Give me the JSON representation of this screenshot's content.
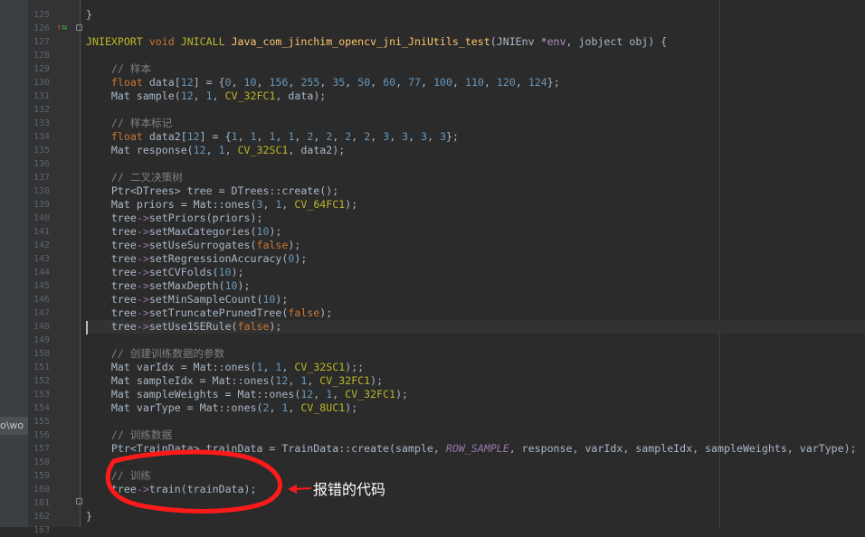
{
  "sidebar_fragment": "o\\wo",
  "line_numbers": [
    "125",
    "126",
    "127",
    "128",
    "129",
    "130",
    "131",
    "132",
    "133",
    "134",
    "135",
    "136",
    "137",
    "138",
    "139",
    "140",
    "141",
    "142",
    "143",
    "144",
    "145",
    "146",
    "147",
    "148",
    "149",
    "150",
    "151",
    "152",
    "153",
    "154",
    "155",
    "156",
    "157",
    "158",
    "159",
    "160",
    "161",
    "162",
    "163"
  ],
  "code_lines": [
    [
      {
        "t": "}",
        "c": ""
      }
    ],
    [],
    [
      {
        "t": "JNIEXPORT ",
        "c": "const"
      },
      {
        "t": "void ",
        "c": "kw"
      },
      {
        "t": "JNICALL ",
        "c": "const"
      },
      {
        "t": "Java_com_jinchim_opencv_jni_JniUtils_test",
        "c": "fn-name"
      },
      {
        "t": "(JNIEnv *",
        "c": ""
      },
      {
        "t": "env",
        "c": "param-env"
      },
      {
        "t": ", jobject ",
        "c": ""
      },
      {
        "t": "obj",
        "c": "param-obj"
      },
      {
        "t": ") {",
        "c": ""
      }
    ],
    [],
    [
      {
        "t": "    // 样本",
        "c": "cmt"
      }
    ],
    [
      {
        "t": "    ",
        "c": ""
      },
      {
        "t": "float ",
        "c": "kw"
      },
      {
        "t": "data[",
        "c": ""
      },
      {
        "t": "12",
        "c": "num"
      },
      {
        "t": "] = {",
        "c": ""
      },
      {
        "t": "0",
        "c": "num"
      },
      {
        "t": ", ",
        "c": ""
      },
      {
        "t": "10",
        "c": "num"
      },
      {
        "t": ", ",
        "c": ""
      },
      {
        "t": "156",
        "c": "num"
      },
      {
        "t": ", ",
        "c": ""
      },
      {
        "t": "255",
        "c": "num"
      },
      {
        "t": ", ",
        "c": ""
      },
      {
        "t": "35",
        "c": "num"
      },
      {
        "t": ", ",
        "c": ""
      },
      {
        "t": "50",
        "c": "num"
      },
      {
        "t": ", ",
        "c": ""
      },
      {
        "t": "60",
        "c": "num"
      },
      {
        "t": ", ",
        "c": ""
      },
      {
        "t": "77",
        "c": "num"
      },
      {
        "t": ", ",
        "c": ""
      },
      {
        "t": "100",
        "c": "num"
      },
      {
        "t": ", ",
        "c": ""
      },
      {
        "t": "110",
        "c": "num"
      },
      {
        "t": ", ",
        "c": ""
      },
      {
        "t": "120",
        "c": "num"
      },
      {
        "t": ", ",
        "c": ""
      },
      {
        "t": "124",
        "c": "num"
      },
      {
        "t": "};",
        "c": ""
      }
    ],
    [
      {
        "t": "    Mat sample(",
        "c": ""
      },
      {
        "t": "12",
        "c": "num"
      },
      {
        "t": ", ",
        "c": ""
      },
      {
        "t": "1",
        "c": "num"
      },
      {
        "t": ", ",
        "c": ""
      },
      {
        "t": "CV_32FC1",
        "c": "const"
      },
      {
        "t": ", data);",
        "c": ""
      }
    ],
    [],
    [
      {
        "t": "    // 样本标记",
        "c": "cmt"
      }
    ],
    [
      {
        "t": "    ",
        "c": ""
      },
      {
        "t": "float ",
        "c": "kw"
      },
      {
        "t": "data2[",
        "c": ""
      },
      {
        "t": "12",
        "c": "num"
      },
      {
        "t": "] = {",
        "c": ""
      },
      {
        "t": "1",
        "c": "num"
      },
      {
        "t": ", ",
        "c": ""
      },
      {
        "t": "1",
        "c": "num"
      },
      {
        "t": ", ",
        "c": ""
      },
      {
        "t": "1",
        "c": "num"
      },
      {
        "t": ", ",
        "c": ""
      },
      {
        "t": "1",
        "c": "num"
      },
      {
        "t": ", ",
        "c": ""
      },
      {
        "t": "2",
        "c": "num"
      },
      {
        "t": ", ",
        "c": ""
      },
      {
        "t": "2",
        "c": "num"
      },
      {
        "t": ", ",
        "c": ""
      },
      {
        "t": "2",
        "c": "num"
      },
      {
        "t": ", ",
        "c": ""
      },
      {
        "t": "2",
        "c": "num"
      },
      {
        "t": ", ",
        "c": ""
      },
      {
        "t": "3",
        "c": "num"
      },
      {
        "t": ", ",
        "c": ""
      },
      {
        "t": "3",
        "c": "num"
      },
      {
        "t": ", ",
        "c": ""
      },
      {
        "t": "3",
        "c": "num"
      },
      {
        "t": ", ",
        "c": ""
      },
      {
        "t": "3",
        "c": "num"
      },
      {
        "t": "};",
        "c": ""
      }
    ],
    [
      {
        "t": "    Mat response(",
        "c": ""
      },
      {
        "t": "12",
        "c": "num"
      },
      {
        "t": ", ",
        "c": ""
      },
      {
        "t": "1",
        "c": "num"
      },
      {
        "t": ", ",
        "c": ""
      },
      {
        "t": "CV_32SC1",
        "c": "const"
      },
      {
        "t": ", data2);",
        "c": ""
      }
    ],
    [],
    [
      {
        "t": "    // 二叉决策树",
        "c": "cmt"
      }
    ],
    [
      {
        "t": "    Ptr<DTrees> tree = DTrees::create();",
        "c": ""
      }
    ],
    [
      {
        "t": "    Mat priors = Mat::ones(",
        "c": ""
      },
      {
        "t": "3",
        "c": "num"
      },
      {
        "t": ", ",
        "c": ""
      },
      {
        "t": "1",
        "c": "num"
      },
      {
        "t": ", ",
        "c": ""
      },
      {
        "t": "CV_64FC1",
        "c": "const"
      },
      {
        "t": ");",
        "c": ""
      }
    ],
    [
      {
        "t": "    tree",
        "c": ""
      },
      {
        "t": "->",
        "c": "arrow"
      },
      {
        "t": "setPriors(priors);",
        "c": ""
      }
    ],
    [
      {
        "t": "    tree",
        "c": ""
      },
      {
        "t": "->",
        "c": "arrow"
      },
      {
        "t": "setMaxCategories(",
        "c": ""
      },
      {
        "t": "10",
        "c": "num"
      },
      {
        "t": ");",
        "c": ""
      }
    ],
    [
      {
        "t": "    tree",
        "c": ""
      },
      {
        "t": "->",
        "c": "arrow"
      },
      {
        "t": "setUseSurrogates(",
        "c": ""
      },
      {
        "t": "false",
        "c": "kw"
      },
      {
        "t": ");",
        "c": ""
      }
    ],
    [
      {
        "t": "    tree",
        "c": ""
      },
      {
        "t": "->",
        "c": "arrow"
      },
      {
        "t": "setRegressionAccuracy(",
        "c": ""
      },
      {
        "t": "0",
        "c": "num"
      },
      {
        "t": ");",
        "c": ""
      }
    ],
    [
      {
        "t": "    tree",
        "c": ""
      },
      {
        "t": "->",
        "c": "arrow"
      },
      {
        "t": "setCVFolds(",
        "c": ""
      },
      {
        "t": "10",
        "c": "num"
      },
      {
        "t": ");",
        "c": ""
      }
    ],
    [
      {
        "t": "    tree",
        "c": ""
      },
      {
        "t": "->",
        "c": "arrow"
      },
      {
        "t": "setMaxDepth(",
        "c": ""
      },
      {
        "t": "10",
        "c": "num"
      },
      {
        "t": ");",
        "c": ""
      }
    ],
    [
      {
        "t": "    tree",
        "c": ""
      },
      {
        "t": "->",
        "c": "arrow"
      },
      {
        "t": "setMinSampleCount(",
        "c": ""
      },
      {
        "t": "10",
        "c": "num"
      },
      {
        "t": ");",
        "c": ""
      }
    ],
    [
      {
        "t": "    tree",
        "c": ""
      },
      {
        "t": "->",
        "c": "arrow"
      },
      {
        "t": "setTruncatePrunedTree(",
        "c": ""
      },
      {
        "t": "false",
        "c": "kw"
      },
      {
        "t": ");",
        "c": ""
      }
    ],
    [
      {
        "t": "    tree",
        "c": ""
      },
      {
        "t": "->",
        "c": "arrow"
      },
      {
        "t": "setUse1SERule(",
        "c": ""
      },
      {
        "t": "false",
        "c": "kw"
      },
      {
        "t": ");",
        "c": ""
      }
    ],
    [],
    [
      {
        "t": "    // 创建训练数据的参数",
        "c": "cmt"
      }
    ],
    [
      {
        "t": "    Mat varIdx = Mat::ones(",
        "c": ""
      },
      {
        "t": "1",
        "c": "num"
      },
      {
        "t": ", ",
        "c": ""
      },
      {
        "t": "1",
        "c": "num"
      },
      {
        "t": ", ",
        "c": ""
      },
      {
        "t": "CV_32SC1",
        "c": "const"
      },
      {
        "t": ");;",
        "c": ""
      }
    ],
    [
      {
        "t": "    Mat sampleIdx = Mat::ones(",
        "c": ""
      },
      {
        "t": "12",
        "c": "num"
      },
      {
        "t": ", ",
        "c": ""
      },
      {
        "t": "1",
        "c": "num"
      },
      {
        "t": ", ",
        "c": ""
      },
      {
        "t": "CV_32FC1",
        "c": "const"
      },
      {
        "t": ");",
        "c": ""
      }
    ],
    [
      {
        "t": "    Mat sampleWeights = Mat::ones(",
        "c": ""
      },
      {
        "t": "12",
        "c": "num"
      },
      {
        "t": ", ",
        "c": ""
      },
      {
        "t": "1",
        "c": "num"
      },
      {
        "t": ", ",
        "c": ""
      },
      {
        "t": "CV_32FC1",
        "c": "const"
      },
      {
        "t": ");",
        "c": ""
      }
    ],
    [
      {
        "t": "    Mat varType = Mat::ones(",
        "c": ""
      },
      {
        "t": "2",
        "c": "num"
      },
      {
        "t": ", ",
        "c": ""
      },
      {
        "t": "1",
        "c": "num"
      },
      {
        "t": ", ",
        "c": ""
      },
      {
        "t": "CV_8UC1",
        "c": "const"
      },
      {
        "t": ");",
        "c": ""
      }
    ],
    [],
    [
      {
        "t": "    // 训练数据",
        "c": "cmt"
      }
    ],
    [
      {
        "t": "    Ptr<TrainData> trainData = TrainData::create(sample, ",
        "c": ""
      },
      {
        "t": "ROW_SAMPLE",
        "c": "italic-const"
      },
      {
        "t": ", response, varIdx, sampleIdx, sampleWeights, varType);",
        "c": ""
      }
    ],
    [],
    [
      {
        "t": "    // 训练",
        "c": "cmt"
      }
    ],
    [
      {
        "t": "    tree",
        "c": ""
      },
      {
        "t": "->",
        "c": "arrow"
      },
      {
        "t": "train(trainData);",
        "c": ""
      }
    ],
    [],
    [
      {
        "t": "}",
        "c": ""
      }
    ],
    []
  ],
  "current_line_index": 23,
  "annotation": {
    "label": "报错的代码",
    "color": "#ff1a1a"
  }
}
